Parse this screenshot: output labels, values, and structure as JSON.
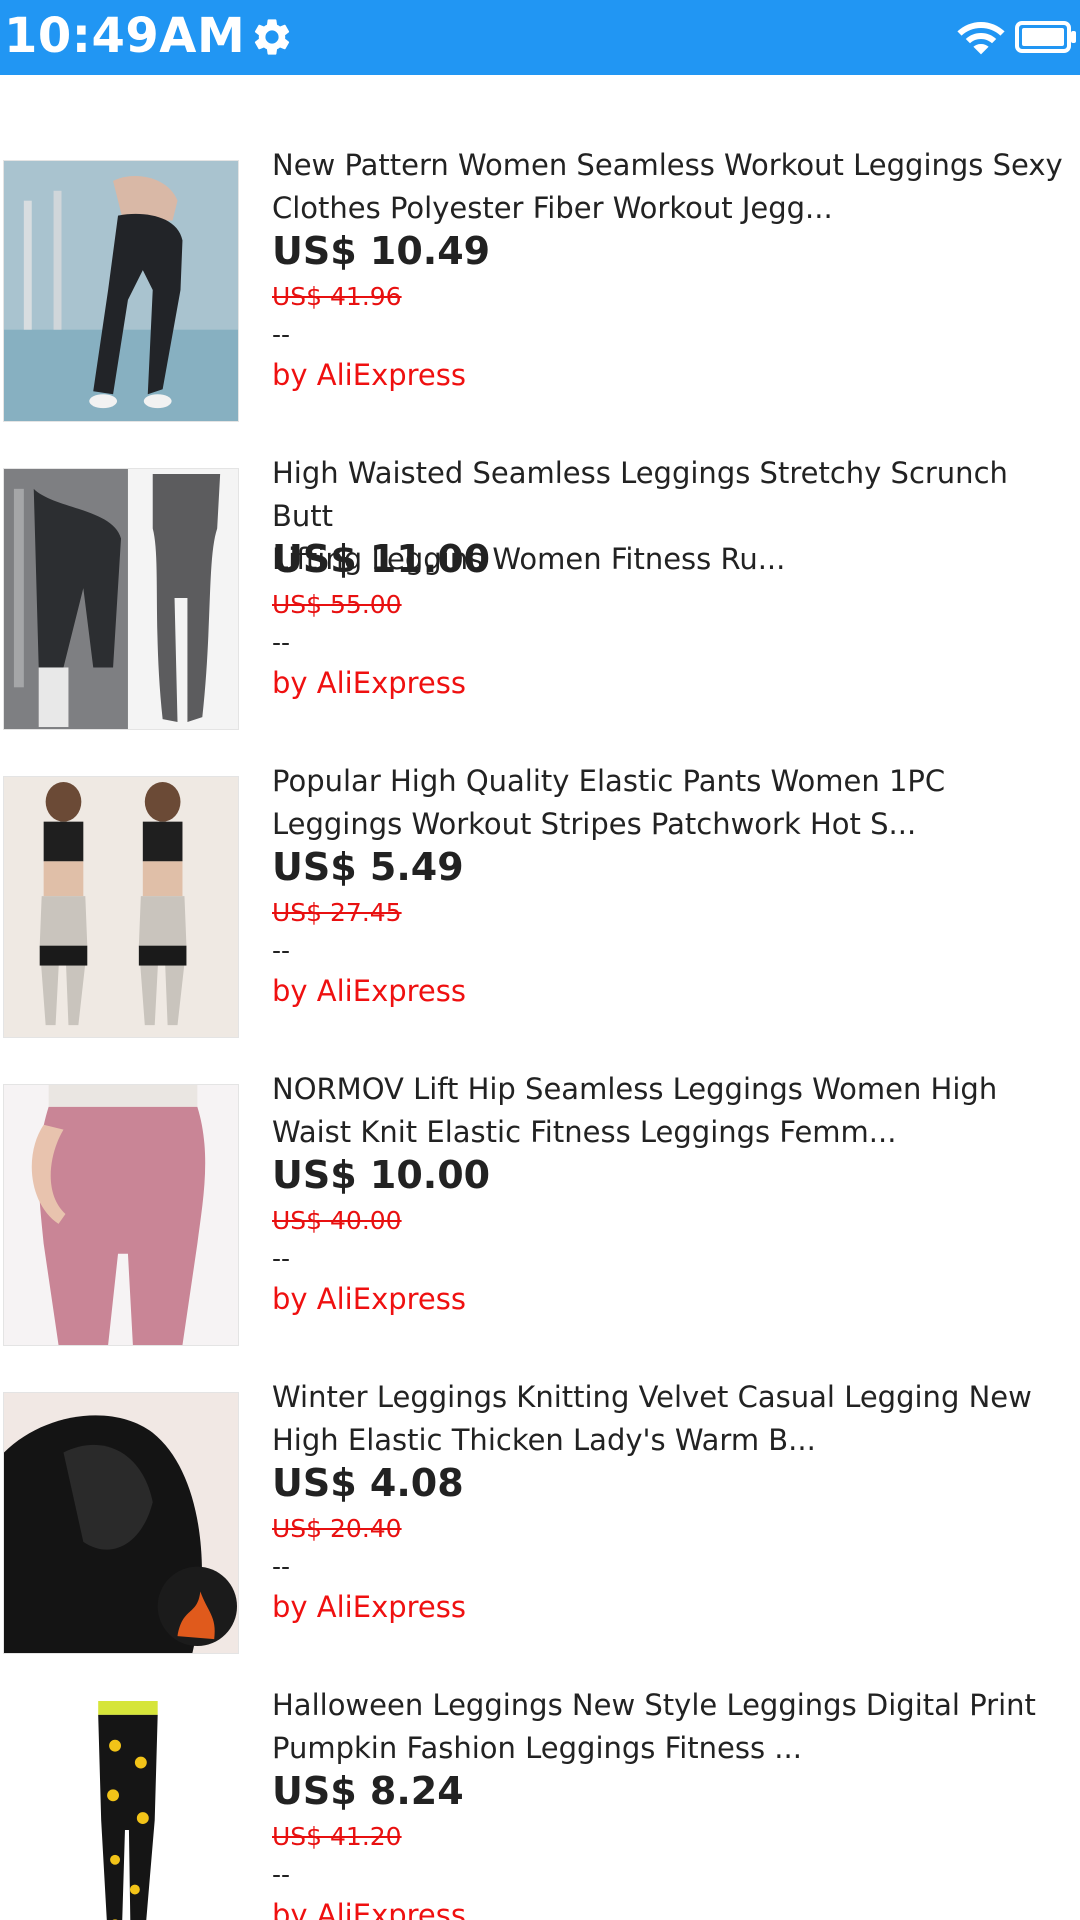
{
  "status_bar": {
    "time": "10:49AM",
    "settings_icon": "gear-icon",
    "wifi_icon": "wifi-icon",
    "battery_icon": "battery-icon",
    "color": "#2196F3"
  },
  "products": [
    {
      "title": "New Pattern Women Seamless Workout Leggings Sexy\nClothes Polyester Fiber Workout Jegg...",
      "price": "US$ 10.49",
      "original_price": "US$ 41.96",
      "rating": "--",
      "seller": "by AliExpress"
    },
    {
      "title": "High Waisted Seamless Leggings Stretchy Scrunch Butt\nLifting Leggins Women Fitness Ru...",
      "price": "US$ 11.00",
      "original_price": "US$ 55.00",
      "rating": "--",
      "seller": "by AliExpress"
    },
    {
      "title": "Popular High Quality Elastic Pants Women 1PC\nLeggings Workout Stripes Patchwork Hot S...",
      "price": "US$ 5.49",
      "original_price": "US$ 27.45",
      "rating": "--",
      "seller": "by AliExpress"
    },
    {
      "title": "NORMOV Lift Hip Seamless Leggings Women High\nWaist Knit Elastic Fitness Leggings Femm...",
      "price": "US$ 10.00",
      "original_price": "US$ 40.00",
      "rating": "--",
      "seller": "by AliExpress"
    },
    {
      "title": "Winter Leggings Knitting Velvet Casual Legging New\nHigh Elastic Thicken Lady's Warm B...",
      "price": "US$ 4.08",
      "original_price": "US$ 20.40",
      "rating": "--",
      "seller": "by AliExpress"
    },
    {
      "title": "Halloween Leggings New Style Leggings Digital Print\nPumpkin Fashion Leggings Fitness ...",
      "price": "US$ 8.24",
      "original_price": "US$ 41.20",
      "rating": "--",
      "seller": "by AliExpress"
    }
  ]
}
